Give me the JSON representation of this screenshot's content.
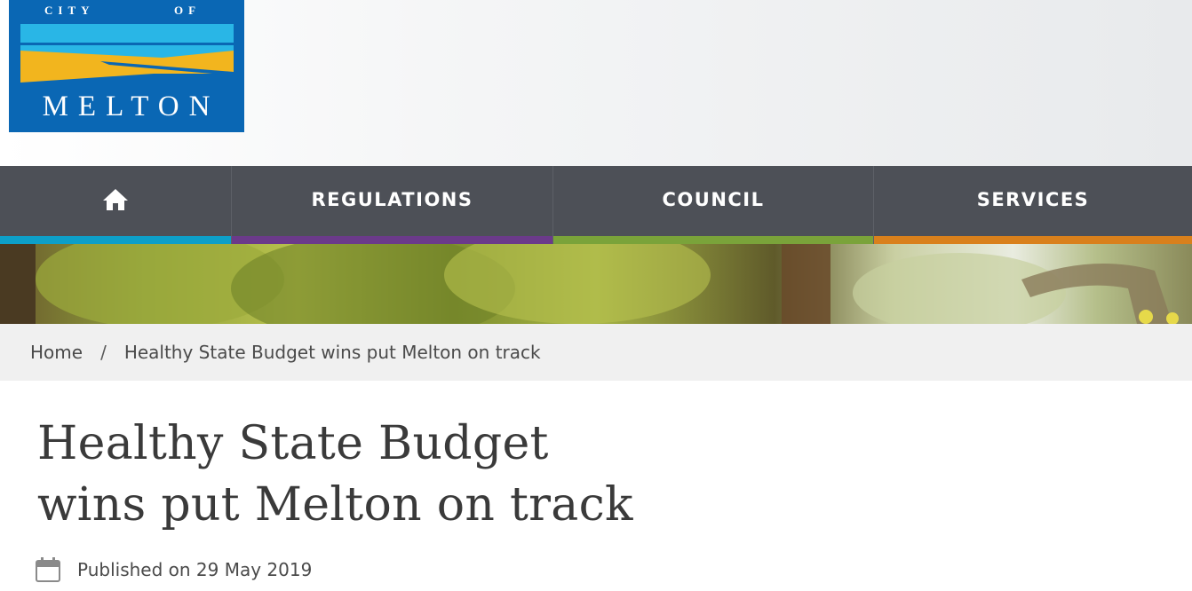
{
  "logo": {
    "top_text_1": "CITY",
    "top_text_2": "OF",
    "name": "MELTON",
    "colors": {
      "background": "#0a67b4",
      "stripe_blue": "#29b6e6",
      "stripe_gold": "#f2b51e"
    }
  },
  "nav": {
    "home_icon": "home-icon",
    "items": [
      {
        "label": "REGULATIONS",
        "accent": "#6b3a8a"
      },
      {
        "label": "COUNCIL",
        "accent": "#7aa33a"
      },
      {
        "label": "SERVICES",
        "accent": "#d9801c"
      }
    ],
    "home_accent": "#0d9fc8"
  },
  "breadcrumb": {
    "home": "Home",
    "separator": "/",
    "current": "Healthy State Budget wins put Melton on track"
  },
  "article": {
    "title": "Healthy State Budget wins put Melton on track",
    "published": "Published on 29 May 2019",
    "published_icon": "calendar-icon"
  }
}
